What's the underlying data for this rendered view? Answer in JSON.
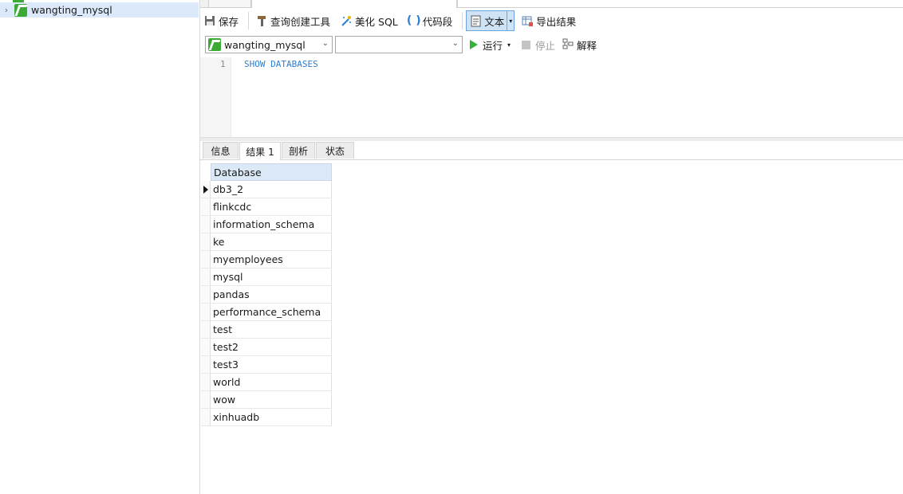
{
  "navigator": {
    "connection_label": "wangting_mysql",
    "expand_icon": "chevron-right-icon",
    "connection_icon": "mysql-connection-icon"
  },
  "toolbar": {
    "save": "保存",
    "query_builder": "查询创建工具",
    "beautify": "美化 SQL",
    "snippet": "代码段",
    "text": "文本",
    "export": "导出结果"
  },
  "run_bar": {
    "connection": "wangting_mysql",
    "database": "",
    "run": "运行",
    "stop": "停止",
    "explain": "解释"
  },
  "editor": {
    "line_number": "1",
    "sql": "SHOW DATABASES"
  },
  "result_tabs": [
    "信息",
    "结果 1",
    "剖析",
    "状态"
  ],
  "active_result_tab": "结果 1",
  "grid": {
    "column": "Database",
    "rows": [
      "db3_2",
      "flinkcdc",
      "information_schema",
      "ke",
      "myemployees",
      "mysql",
      "pandas",
      "performance_schema",
      "test",
      "test2",
      "test3",
      "world",
      "wow",
      "xinhuadb"
    ],
    "current_row": 0
  },
  "colors": {
    "accent": "#3aaa35",
    "selection": "#dbe9fb",
    "sql_keyword": "#2d7fd0"
  }
}
